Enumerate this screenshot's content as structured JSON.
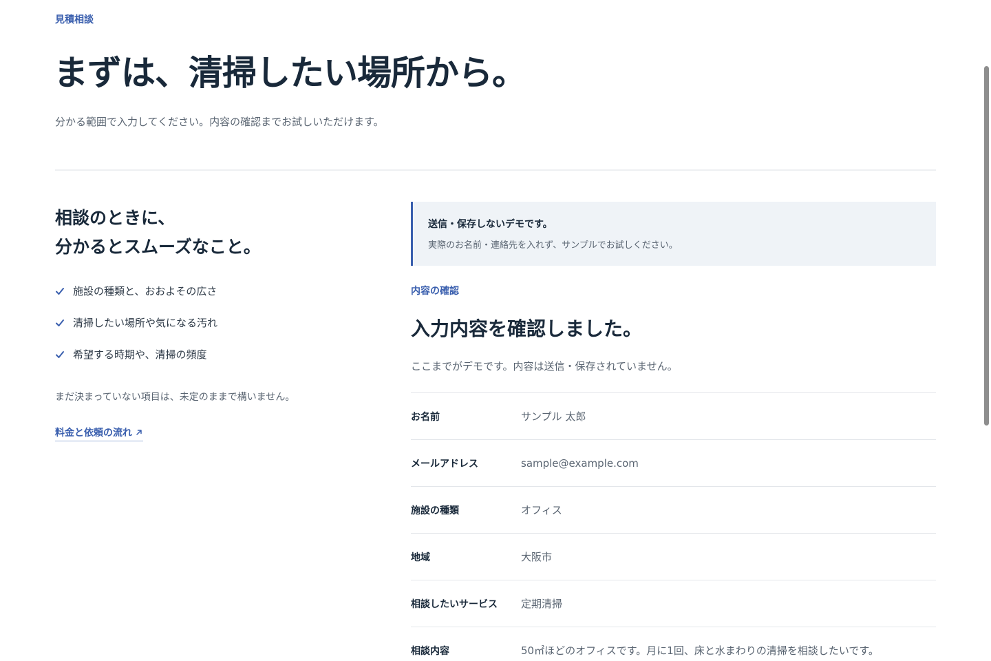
{
  "header": {
    "eyebrow": "見積相談",
    "title": "まずは、清掃したい場所から。",
    "lead": "分かる範囲で入力してください。内容の確認までお試しいただけます。"
  },
  "guide": {
    "title_line1": "相談のときに、",
    "title_line2": "分かるとスムーズなこと。",
    "items": [
      {
        "label": "施設の種類と、おおよその広さ",
        "icon": "check-icon"
      },
      {
        "label": "清掃したい場所や気になる汚れ",
        "icon": "check-icon"
      },
      {
        "label": "希望する時期や、清掃の頻度",
        "icon": "check-icon"
      }
    ],
    "note": "まだ決まっていない項目は、未定のままで構いません。",
    "link_label": "料金と依頼の流れ",
    "link_icon": "external-arrow-icon"
  },
  "notice": {
    "title": "送信・保存しないデモです。",
    "body": "実際のお名前・連絡先を入れず、サンプルでお試しください。"
  },
  "confirmation": {
    "eyebrow": "内容の確認",
    "title": "入力内容を確認しました。",
    "lead": "ここまでがデモです。内容は送信・保存されていません。",
    "rows": [
      {
        "key": "お名前",
        "value": "サンプル 太郎"
      },
      {
        "key": "メールアドレス",
        "value": "sample@example.com"
      },
      {
        "key": "施設の種類",
        "value": "オフィス"
      },
      {
        "key": "地域",
        "value": "大阪市"
      },
      {
        "key": "相談したいサービス",
        "value": "定期清掃"
      },
      {
        "key": "相談内容",
        "value": "50㎡ほどのオフィスです。月に1回、床と水まわりの清掃を相談したいです。"
      }
    ]
  },
  "colors": {
    "accent": "#3a5fae",
    "heading": "#19293a",
    "muted": "#5a6572",
    "notice_bg": "#eff3f7"
  }
}
